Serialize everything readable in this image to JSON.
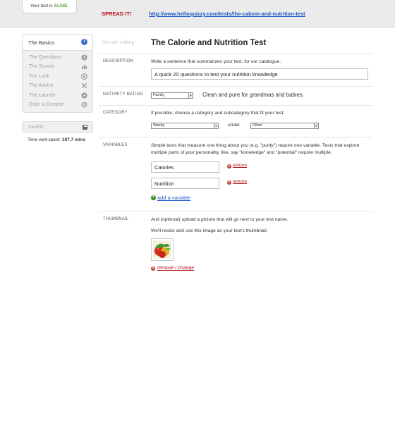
{
  "header": {
    "status_prefix": "Your test is",
    "status_value": "ALIVE",
    "status_suffix": ".",
    "spread_label": "SPREAD IT!",
    "share_url": "http://www.helloquizzy.com/tests/the-calorie-and-nutrition-test"
  },
  "sidebar": {
    "current": "The Basics",
    "items": [
      {
        "label": "The Questions",
        "icon": "question-icon"
      },
      {
        "label": "The Scores",
        "icon": "bar-chart-icon"
      },
      {
        "label": "The Look",
        "icon": "palette-icon"
      },
      {
        "label": "The Advice",
        "icon": "tools-icon"
      },
      {
        "label": "The Launch",
        "icon": "play-icon"
      },
      {
        "label": "Enter a Contest",
        "icon": "award-icon"
      }
    ],
    "saved_label": "SAVED.",
    "time_prefix": "Time well-spent:",
    "time_value": "107.7 mins"
  },
  "editor": {
    "editing_label": "You are editing:",
    "title": "The Calorie and Nutrition Test"
  },
  "description": {
    "label": "DESCRIPTION",
    "help": "Write a sentence that summarizes your test, for our catalogue.",
    "value": "A quick 20 questions to test your nutrition knowledge"
  },
  "maturity": {
    "label": "MATURITY RATING",
    "selected": "Family",
    "note": "Clean and pure for grandmas and babies."
  },
  "category": {
    "label": "CATEGORY",
    "help": "If possible, choose a category and subcategory that fit your test.",
    "category_selected": "Wacky",
    "under_label": "under",
    "subcategory_selected": "Other"
  },
  "variables": {
    "label": "VARIABLES",
    "help": "Simple tests that measure one thing about you (e.g. \"purity\") require one variable. Tests that explore multiple parts of your personality, like, say \"knowledge\" and \"potential\" require multiple.",
    "items": [
      {
        "value": "Calories",
        "remove_label": "remove"
      },
      {
        "value": "Nutrition",
        "remove_label": "remove"
      }
    ],
    "add_label": "add a variable"
  },
  "thumbnail": {
    "label": "THUMBNAIL",
    "help_line1": "And (optional) upload a picture that will go next to your test name.",
    "help_line2": "We'll resize and use this image as your test's thumbnail:",
    "remove_label": "remove / change"
  },
  "colors": {
    "alive": "#4aa02c",
    "spread": "#b5121b",
    "link": "#1a57c8",
    "remove": "#b5121b",
    "info": "#3e6fc9"
  }
}
